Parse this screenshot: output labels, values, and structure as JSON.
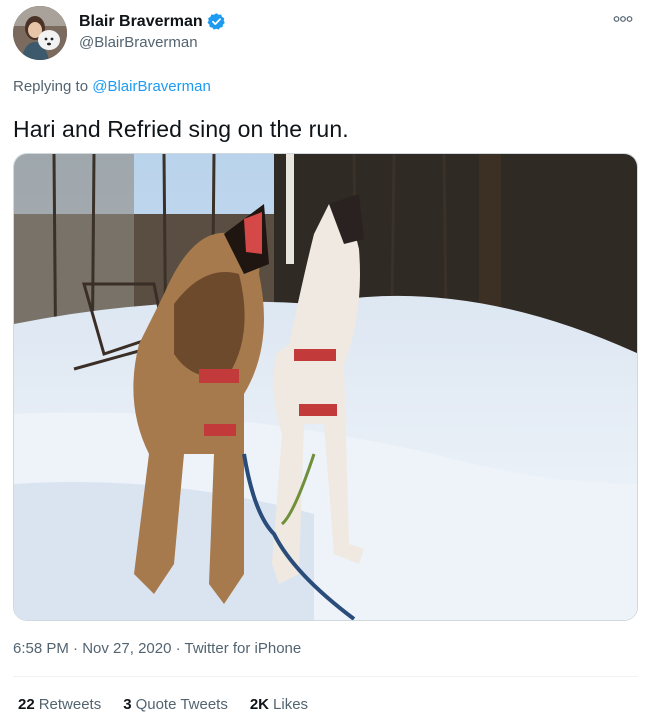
{
  "author": {
    "display_name": "Blair Braverman",
    "handle": "@BlairBraverman",
    "verified_icon": "verified-badge-icon"
  },
  "reply": {
    "prefix": "Replying to ",
    "mention": "@BlairBraverman"
  },
  "tweet": {
    "text": "Hari and Refried sing on the run."
  },
  "media": {
    "icon": "photo"
  },
  "meta": {
    "time": "6:58 PM",
    "separator1": " · ",
    "date": "Nov 27, 2020",
    "separator2": " · ",
    "source": "Twitter for iPhone"
  },
  "stats": {
    "retweets_count": "22",
    "retweets_label": "Retweets",
    "quotes_count": "3",
    "quotes_label": "Quote Tweets",
    "likes_count": "2K",
    "likes_label": "Likes"
  },
  "colors": {
    "accent": "#1d9bf0",
    "text": "#0f1419",
    "muted": "#536471"
  }
}
